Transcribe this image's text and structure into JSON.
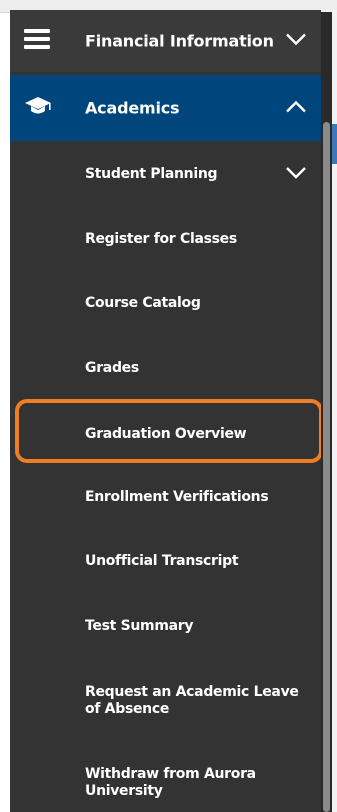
{
  "menu": {
    "top_item": {
      "label": "Financial Information",
      "icon": "hamburger-icon",
      "chevron": "chevron-down-icon"
    },
    "section": {
      "label": "Academics",
      "icon": "graduation-cap-icon",
      "chevron": "chevron-up-icon"
    },
    "sub_items": [
      {
        "label": "Student Planning",
        "has_chevron": true
      },
      {
        "label": "Register for Classes"
      },
      {
        "label": "Course Catalog"
      },
      {
        "label": "Grades"
      },
      {
        "label": "Graduation Overview",
        "highlighted": true
      },
      {
        "label": "Enrollment Verifications"
      },
      {
        "label": "Unofficial Transcript"
      },
      {
        "label": "Test Summary"
      },
      {
        "label": "Request an Academic Leave of Absence"
      },
      {
        "label": "Withdraw from Aurora University"
      }
    ]
  },
  "colors": {
    "panel": "#333333",
    "section_active": "#00457c",
    "highlight_outline": "#ee7d23"
  }
}
